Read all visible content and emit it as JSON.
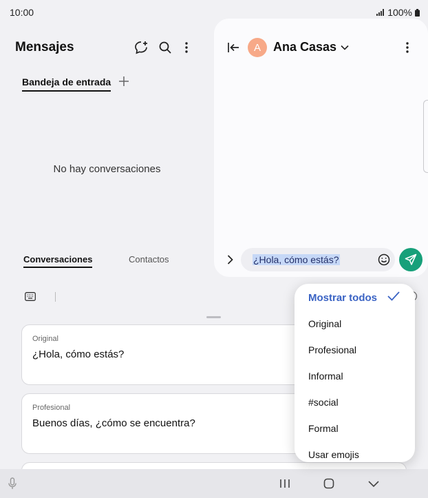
{
  "status_bar": {
    "time": "10:00",
    "battery": "100%"
  },
  "left_pane": {
    "title": "Mensajes",
    "tabs": [
      {
        "label": "Bandeja de entrada"
      }
    ],
    "empty_state": "No hay conversaciones"
  },
  "chat": {
    "contact_initial": "A",
    "contact_name": "Ana Casas",
    "input_text": "¿Hola, cómo estás?"
  },
  "bottom_tabs": {
    "conversations": "Conversaciones",
    "contacts": "Contactos"
  },
  "suggestions": [
    {
      "label": "Original",
      "text": "¿Hola, cómo estás?"
    },
    {
      "label": "Profesional",
      "text": "Buenos días, ¿cómo se encuentra?"
    }
  ],
  "tone_menu": {
    "selected": "Mostrar todos",
    "items": [
      "Original",
      "Profesional",
      "Informal",
      "#social",
      "Formal",
      "Usar emojis"
    ]
  },
  "colors": {
    "accent": "#3a63c4",
    "send": "#17a07a",
    "avatar": "#f7a988",
    "selection": "#c6d8f7"
  },
  "icons": [
    "new-chat-icon",
    "search-icon",
    "more-icon",
    "collapse-icon",
    "chevron-down-icon",
    "expand-icon",
    "emoji-icon",
    "send-icon",
    "keyboard-icon",
    "check-icon",
    "mic-icon",
    "recents-icon",
    "home-icon",
    "back-icon"
  ]
}
